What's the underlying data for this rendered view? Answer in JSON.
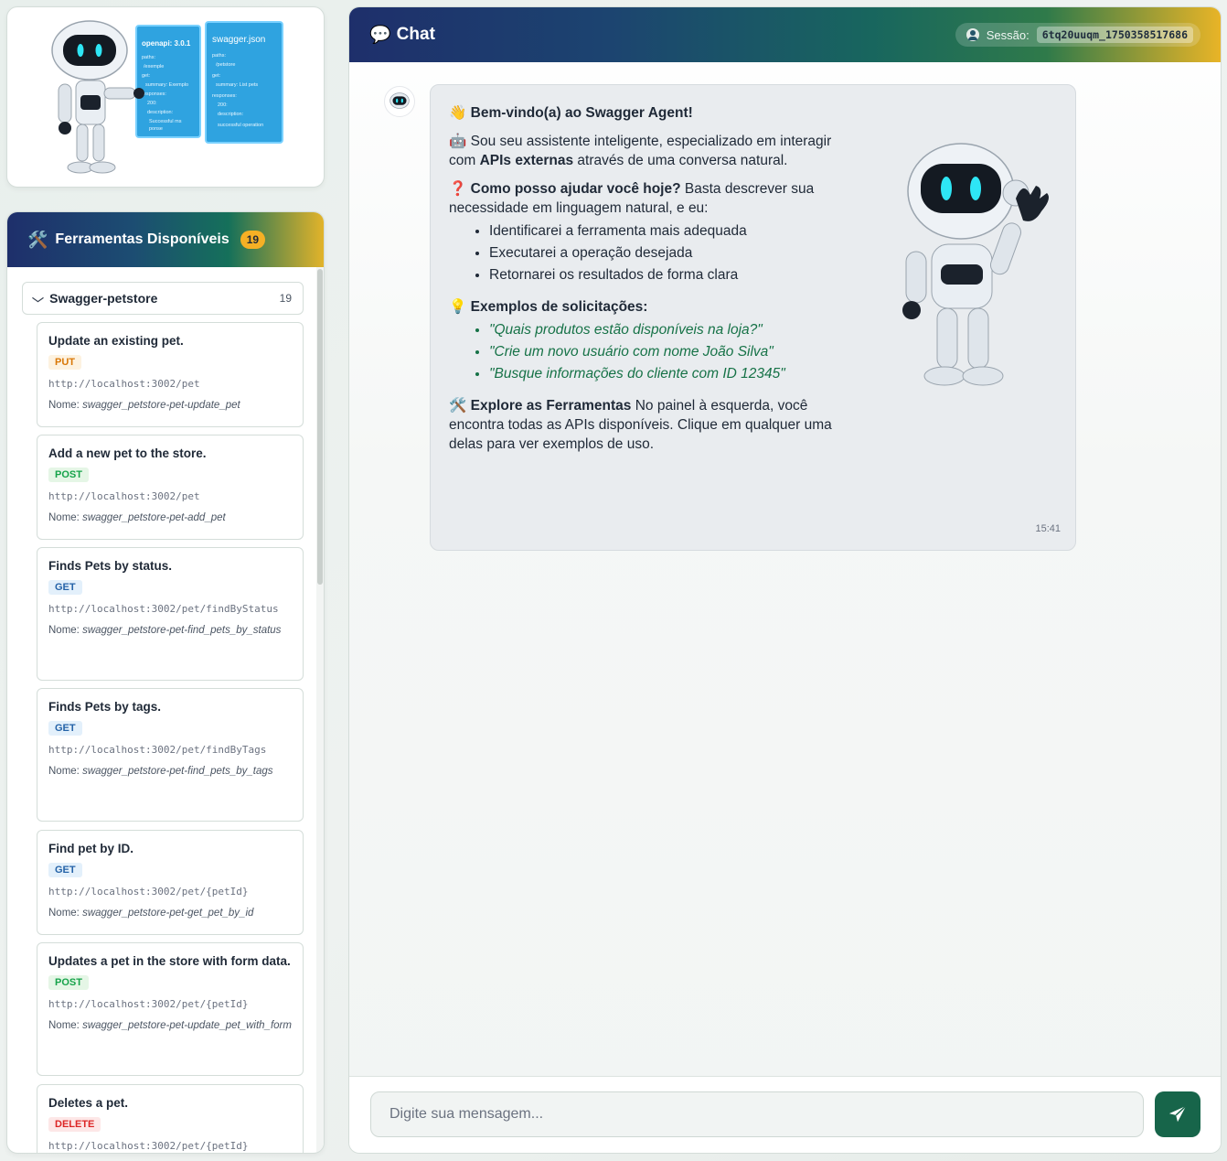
{
  "logo": {
    "panel1_title": "openapi: 3.0.1",
    "panel1_lines": [
      "paths:",
      "/exemple",
      "get:",
      "summary: Exemplo",
      "responses:",
      "200:",
      "description:",
      "Successful ms",
      "ponse"
    ],
    "panel2_title": "swagger.json",
    "panel2_lines": [
      "paths:",
      "/petstore",
      "get:",
      "summary: List pets",
      "responses:",
      "200:",
      "description:",
      "successful operation"
    ]
  },
  "tools": {
    "header_icon": "🛠️",
    "title": "Ferramentas Disponíveis",
    "count": "19",
    "group": {
      "name": "Swagger-petstore",
      "count": "19"
    },
    "name_label": "Nome:",
    "items": [
      {
        "title": "Update an existing pet.",
        "method": "PUT",
        "url": "http://localhost:3002/pet",
        "name": "swagger_petstore-pet-update_pet"
      },
      {
        "title": "Add a new pet to the store.",
        "method": "POST",
        "url": "http://localhost:3002/pet",
        "name": "swagger_petstore-pet-add_pet"
      },
      {
        "title": "Finds Pets by status.",
        "method": "GET",
        "url": "http://localhost:3002/pet/findByStatus",
        "name": "swagger_petstore-pet-find_pets_by_status"
      },
      {
        "title": "Finds Pets by tags.",
        "method": "GET",
        "url": "http://localhost:3002/pet/findByTags",
        "name": "swagger_petstore-pet-find_pets_by_tags"
      },
      {
        "title": "Find pet by ID.",
        "method": "GET",
        "url": "http://localhost:3002/pet/{petId}",
        "name": "swagger_petstore-pet-get_pet_by_id"
      },
      {
        "title": "Updates a pet in the store with form data.",
        "method": "POST",
        "url": "http://localhost:3002/pet/{petId}",
        "name": "swagger_petstore-pet-update_pet_with_form"
      },
      {
        "title": "Deletes a pet.",
        "method": "DELETE",
        "url": "http://localhost:3002/pet/{petId}",
        "name": ""
      }
    ]
  },
  "chat": {
    "title": "Chat",
    "title_icon": "💬",
    "session_label": "Sessão:",
    "session_id": "6tq20uuqm_1750358517686",
    "message": {
      "greeting_icon": "👋",
      "greeting": "Bem-vindo(a) ao Swagger Agent!",
      "intro_icon": "🤖",
      "intro_a": "Sou seu assistente inteligente, especializado em interagir com ",
      "intro_b": "APIs externas",
      "intro_c": " através de uma conversa natural.",
      "help_icon": "❓",
      "help_q": "Como posso ajudar você hoje?",
      "help_text": " Basta descrever sua necessidade em linguagem natural, e eu:",
      "steps": [
        "Identificarei a ferramenta mais adequada",
        "Executarei a operação desejada",
        "Retornarei os resultados de forma clara"
      ],
      "examples_icon": "💡",
      "examples_title": "Exemplos de solicitações:",
      "examples": [
        "\"Quais produtos estão disponíveis na loja?\"",
        "\"Crie um novo usuário com nome João Silva\"",
        "\"Busque informações do cliente com ID 12345\""
      ],
      "explore_icon": "🛠️",
      "explore_title": "Explore as Ferramentas",
      "explore_text": " No painel à esquerda, você encontra todas as APIs disponíveis. Clique em qualquer uma delas para ver exemplos de uso.",
      "time": "15:41"
    },
    "input_placeholder": "Digite sua mensagem..."
  },
  "colors": {
    "brand_green": "#17654a",
    "header_navy": "#1e2f6b",
    "accent_yellow": "#f5b025"
  }
}
